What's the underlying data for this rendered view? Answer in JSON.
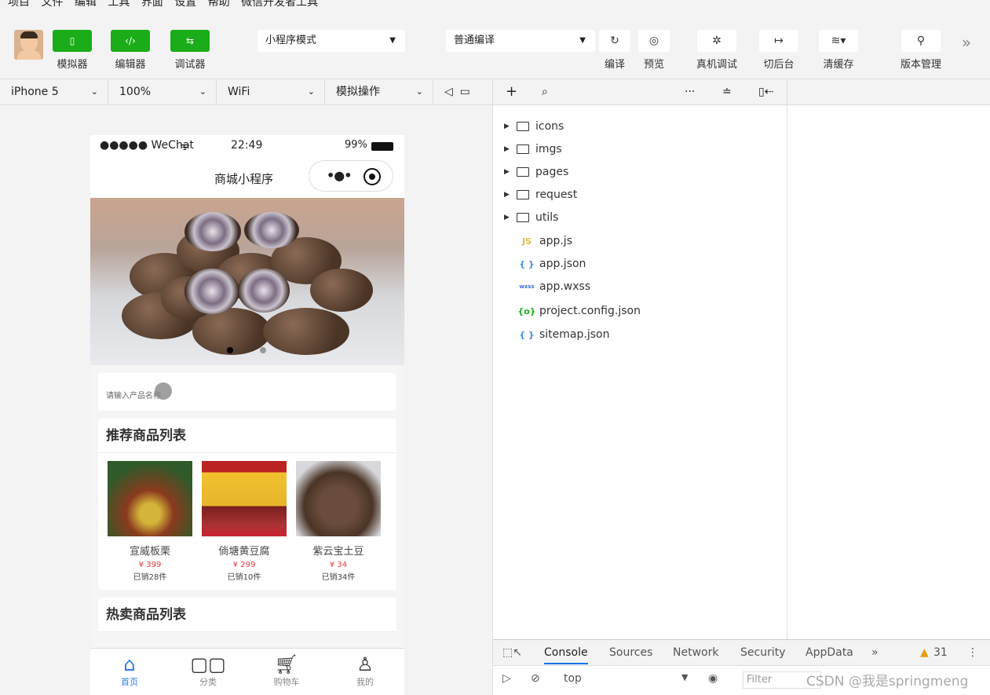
{
  "menu": [
    "项目",
    "文件",
    "编辑",
    "工具",
    "界面",
    "设置",
    "帮助",
    "微信开发者工具"
  ],
  "toolbar": {
    "simulator": "模拟器",
    "editor": "编辑器",
    "debugger": "调试器",
    "mode": "小程序模式",
    "compile_mode": "普通编译",
    "compile": "编译",
    "preview": "预览",
    "real_debug": "真机调试",
    "background": "切后台",
    "clear_cache": "清缓存",
    "version": "版本管理"
  },
  "subbar": {
    "device": "iPhone 5",
    "zoom": "100%",
    "network": "WiFi",
    "simulate": "模拟操作"
  },
  "phone": {
    "carrier": "●●●●● WeChat",
    "time": "22:49",
    "battery": "99%",
    "title": "商城小程序",
    "search_placeholder": "请输入产品名称",
    "recommend_title": "推荐商品列表",
    "hot_title": "热卖商品列表",
    "goods": [
      {
        "name": "宣威板栗",
        "price": "¥ 399",
        "sold": "已销28件"
      },
      {
        "name": "倘塘黄豆腐",
        "price": "¥ 299",
        "sold": "已销10件"
      },
      {
        "name": "紫云宝土豆",
        "price": "¥ 34",
        "sold": "已销34件"
      }
    ],
    "tabs": [
      "首页",
      "分类",
      "购物车",
      "我的"
    ]
  },
  "files": [
    {
      "name": "icons",
      "type": "folder"
    },
    {
      "name": "imgs",
      "type": "folder"
    },
    {
      "name": "pages",
      "type": "folder"
    },
    {
      "name": "request",
      "type": "folder"
    },
    {
      "name": "utils",
      "type": "folder"
    },
    {
      "name": "app.js",
      "type": "js"
    },
    {
      "name": "app.json",
      "type": "json"
    },
    {
      "name": "app.wxss",
      "type": "wxss"
    },
    {
      "name": "project.config.json",
      "type": "config"
    },
    {
      "name": "sitemap.json",
      "type": "json"
    }
  ],
  "devtools": {
    "tabs": [
      "Console",
      "Sources",
      "Network",
      "Security",
      "AppData"
    ],
    "warnings": "31",
    "context": "top",
    "filter_placeholder": "Filter"
  },
  "watermark": "CSDN @我是springmeng"
}
